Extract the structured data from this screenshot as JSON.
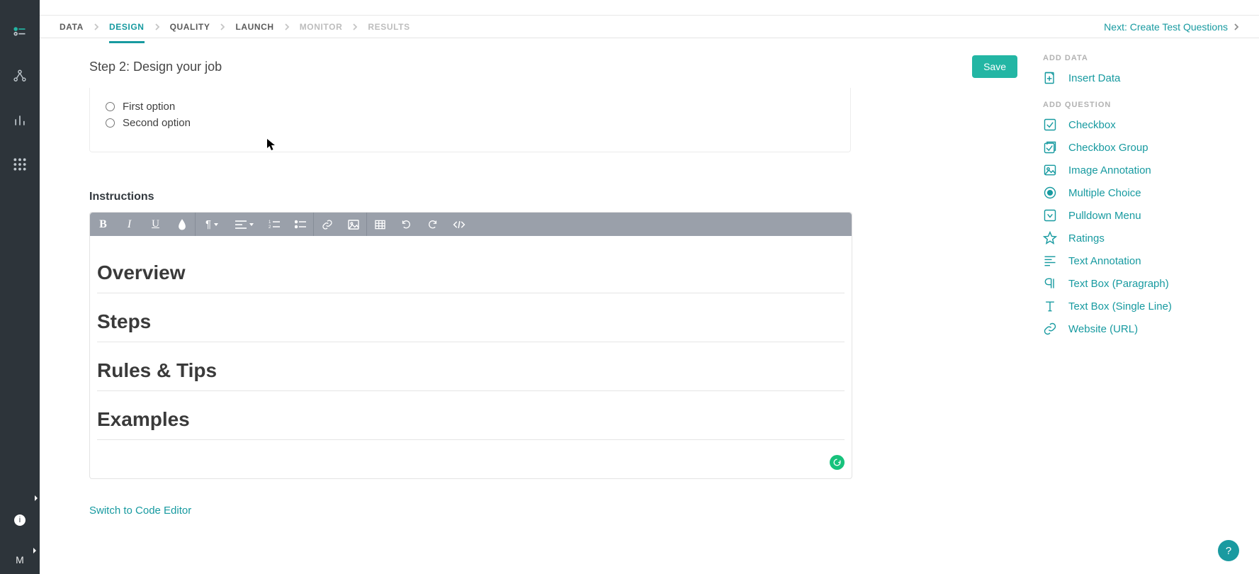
{
  "workflow": {
    "steps": [
      "DATA",
      "DESIGN",
      "QUALITY",
      "LAUNCH",
      "MONITOR",
      "RESULTS"
    ],
    "next_label": "Next: Create Test Questions"
  },
  "header": {
    "title": "Step 2: Design your job",
    "save": "Save"
  },
  "options": {
    "opt1": "First option",
    "opt2": "Second option"
  },
  "instructions": {
    "label": "Instructions",
    "h1": "Overview",
    "h2": "Steps",
    "h3": "Rules & Tips",
    "h4": "Examples"
  },
  "switch_link": "Switch to Code Editor",
  "sidebar": {
    "group1_title": "ADD DATA",
    "group1": [
      {
        "label": "Insert Data"
      }
    ],
    "group2_title": "ADD QUESTION",
    "group2": [
      {
        "label": "Checkbox"
      },
      {
        "label": "Checkbox Group"
      },
      {
        "label": "Image Annotation"
      },
      {
        "label": "Multiple Choice"
      },
      {
        "label": "Pulldown Menu"
      },
      {
        "label": "Ratings"
      },
      {
        "label": "Text Annotation"
      },
      {
        "label": "Text Box (Paragraph)"
      },
      {
        "label": "Text Box (Single Line)"
      },
      {
        "label": "Website (URL)"
      }
    ]
  },
  "rail": {
    "letter": "M"
  },
  "help": "?"
}
